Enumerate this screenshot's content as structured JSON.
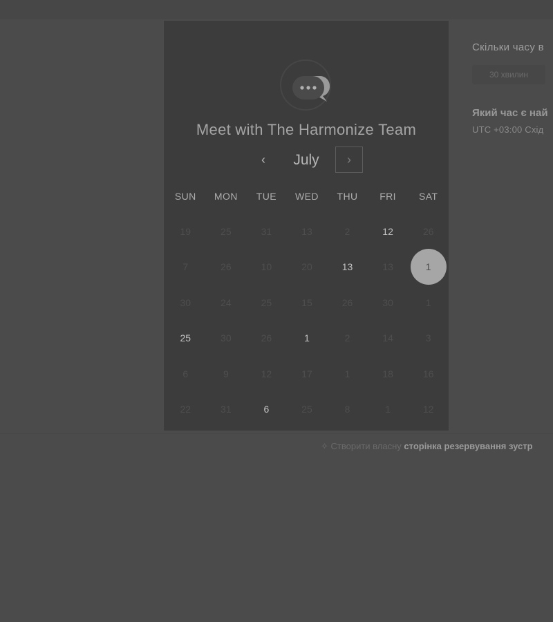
{
  "booking": {
    "title": "Meet with The Harmonize Team",
    "logo_icon": "chat-bubble-icon",
    "calendar": {
      "month": "July",
      "prev_icon": "‹",
      "next_icon": "›",
      "weekdays": [
        "SUN",
        "MON",
        "TUE",
        "WED",
        "THU",
        "FRI",
        "SAT"
      ],
      "days": [
        {
          "label": "19",
          "available": false
        },
        {
          "label": "25",
          "available": false
        },
        {
          "label": "31",
          "available": false
        },
        {
          "label": "13",
          "available": false
        },
        {
          "label": "2",
          "available": false
        },
        {
          "label": "12",
          "available": true
        },
        {
          "label": "26",
          "available": false
        },
        {
          "label": "7",
          "available": false
        },
        {
          "label": "26",
          "available": false
        },
        {
          "label": "10",
          "available": false
        },
        {
          "label": "20",
          "available": false
        },
        {
          "label": "13",
          "available": true
        },
        {
          "label": "13",
          "available": false
        },
        {
          "label": "1",
          "available": true,
          "selected": true
        },
        {
          "label": "30",
          "available": false
        },
        {
          "label": "24",
          "available": false
        },
        {
          "label": "25",
          "available": false
        },
        {
          "label": "15",
          "available": false
        },
        {
          "label": "26",
          "available": false
        },
        {
          "label": "30",
          "available": false
        },
        {
          "label": "1",
          "available": false
        },
        {
          "label": "25",
          "available": true
        },
        {
          "label": "30",
          "available": false
        },
        {
          "label": "26",
          "available": false
        },
        {
          "label": "1",
          "available": true
        },
        {
          "label": "2",
          "available": false
        },
        {
          "label": "14",
          "available": false
        },
        {
          "label": "3",
          "available": false
        },
        {
          "label": "6",
          "available": false
        },
        {
          "label": "9",
          "available": false
        },
        {
          "label": "12",
          "available": false
        },
        {
          "label": "17",
          "available": false
        },
        {
          "label": "1",
          "available": false
        },
        {
          "label": "18",
          "available": false
        },
        {
          "label": "16",
          "available": false
        },
        {
          "label": "22",
          "available": false
        },
        {
          "label": "31",
          "available": false
        },
        {
          "label": "6",
          "available": true
        },
        {
          "label": "25",
          "available": false
        },
        {
          "label": "8",
          "available": false
        },
        {
          "label": "1",
          "available": false
        },
        {
          "label": "12",
          "available": false
        }
      ]
    }
  },
  "side": {
    "duration_heading": "Скільки часу в",
    "duration_option": "30 хвилин",
    "time_heading": "Який час є най",
    "timezone": "UTC +03:00 Схід"
  },
  "footer": {
    "icon": "sparkle-icon",
    "prefix": "Створити власну ",
    "emph": "сторінка резервування зустр"
  },
  "colors": {
    "page_background": "#4b4b4b",
    "card_background": "#3c3c3c",
    "selected_day": "#a6a6a6"
  }
}
